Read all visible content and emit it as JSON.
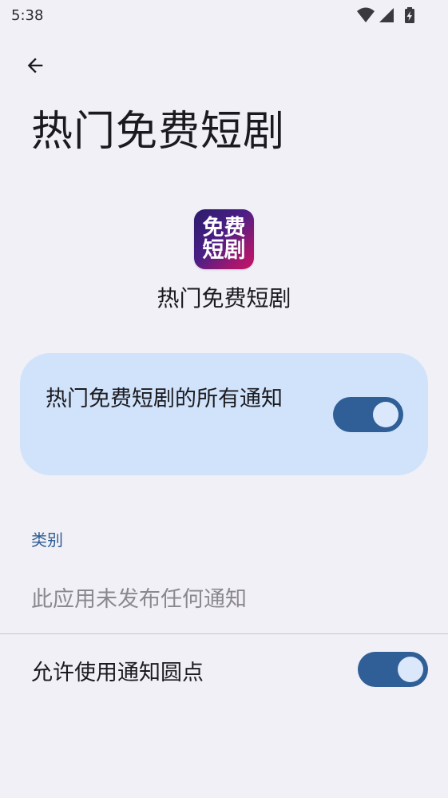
{
  "status_bar": {
    "time": "5:38",
    "icons": [
      "wifi-icon",
      "signal-icon",
      "battery-charging-icon"
    ]
  },
  "header": {
    "back_icon": "arrow-back-icon",
    "title": "热门免费短剧"
  },
  "app": {
    "icon_text": "免费短剧",
    "name": "热门免费短剧"
  },
  "main_switch": {
    "label": "热门免费短剧的所有通知",
    "checked": true
  },
  "categories": {
    "header": "类别",
    "empty_text": "此应用未发布任何通知"
  },
  "dot_setting": {
    "label": "允许使用通知圆点",
    "checked": true
  },
  "colors": {
    "background": "#f1f0f6",
    "card": "#d1e3fb",
    "toggle_track": "#2f5f96",
    "accent_text": "#2e5c93"
  }
}
